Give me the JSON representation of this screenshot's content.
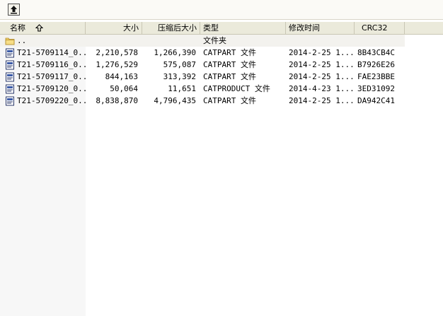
{
  "columns": {
    "name": "名称",
    "size": "大小",
    "compressed": "压缩后大小",
    "type": "类型",
    "modified": "修改时间",
    "crc": "CRC32"
  },
  "parent_row": {
    "name": "..",
    "type": "文件夹"
  },
  "rows": [
    {
      "name": "T21-5709114_0...",
      "size": "2,210,578",
      "compressed": "1,266,390",
      "type": "CATPART 文件",
      "modified": "2014-2-25 1...",
      "crc": "8B43CB4C"
    },
    {
      "name": "T21-5709116_0...",
      "size": "1,276,529",
      "compressed": "575,087",
      "type": "CATPART 文件",
      "modified": "2014-2-25 1...",
      "crc": "B7926E26"
    },
    {
      "name": "T21-5709117_0...",
      "size": "844,163",
      "compressed": "313,392",
      "type": "CATPART 文件",
      "modified": "2014-2-25 1...",
      "crc": "FAE23BBE"
    },
    {
      "name": "T21-5709120_0...",
      "size": "50,064",
      "compressed": "11,651",
      "type": "CATPRODUCT 文件",
      "modified": "2014-4-23 1...",
      "crc": "3ED31092"
    },
    {
      "name": "T21-5709220_0...",
      "size": "8,838,870",
      "compressed": "4,796,435",
      "type": "CATPART 文件",
      "modified": "2014-2-25 1...",
      "crc": "DA942C41"
    }
  ],
  "icons": {
    "up": "up-folder-icon",
    "sort": "sort-up-arrow-icon",
    "folder": "folder-icon",
    "file": "catia-file-icon"
  },
  "colors": {
    "header_bg": "#ebeadb",
    "toolbar_bg": "#fbfaf6",
    "name_col_bg": "#f7f7f7"
  }
}
